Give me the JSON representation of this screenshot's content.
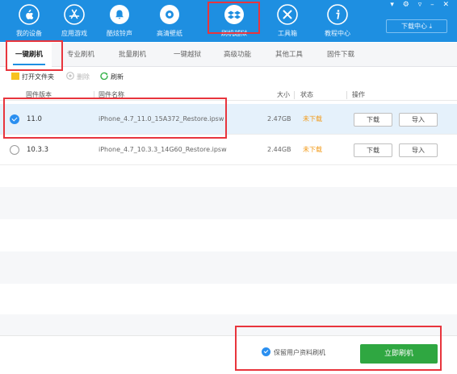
{
  "window": {
    "controls": "▾ ⚙ ▿ – ✕",
    "download_center": "下载中心 ⤓"
  },
  "nav": [
    {
      "label": "我的设备",
      "icon": "apple-icon"
    },
    {
      "label": "应用游戏",
      "icon": "app-store-icon"
    },
    {
      "label": "酷炫铃声",
      "icon": "bell-icon"
    },
    {
      "label": "高清壁纸",
      "icon": "wallpaper-icon"
    },
    {
      "label": "刷机越狱",
      "icon": "dropbox-icon"
    },
    {
      "label": "工具箱",
      "icon": "tools-icon"
    },
    {
      "label": "教程中心",
      "icon": "info-icon"
    }
  ],
  "tabs": [
    "一键刷机",
    "专业刷机",
    "批量刷机",
    "一键越狱",
    "高级功能",
    "其他工具",
    "固件下载"
  ],
  "toolbar": {
    "open_folder": "打开文件夹",
    "delete": "删除",
    "refresh": "刷新"
  },
  "table": {
    "headers": {
      "version": "固件版本",
      "name": "固件名称",
      "size": "大小",
      "status": "状态",
      "actions": "操作"
    },
    "rows": [
      {
        "version": "11.0",
        "name": "iPhone_4.7_11.0_15A372_Restore.ipsw",
        "size": "2.47GB",
        "status": "未下载",
        "download": "下载",
        "import": "导入",
        "selected": true
      },
      {
        "version": "10.3.3",
        "name": "iPhone_4.7_10.3.3_14G60_Restore.ipsw",
        "size": "2.44GB",
        "status": "未下载",
        "download": "下载",
        "import": "导入",
        "selected": false
      }
    ]
  },
  "footer": {
    "keep_data": "保留用户资料刷机",
    "flash_now": "立即刷机"
  },
  "colors": {
    "topbar": "#1e8fe1",
    "status_pending": "#f29a18",
    "primary_button": "#2fa741",
    "annotation": "#e8353d"
  }
}
